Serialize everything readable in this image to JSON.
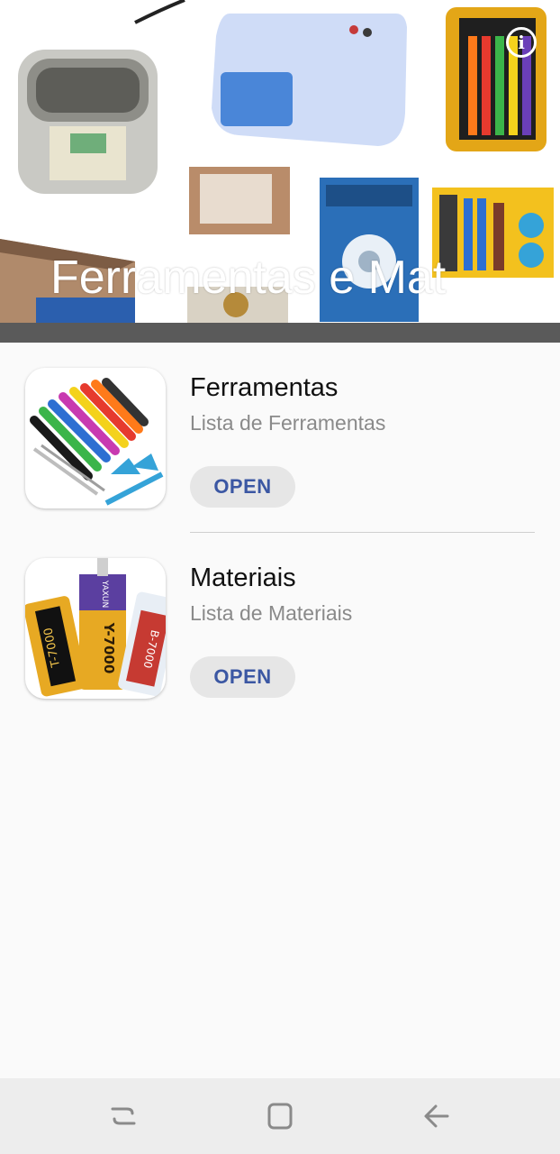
{
  "header": {
    "title": "Ferramentas e Mat",
    "info_icon": "info-icon",
    "info_glyph": "i"
  },
  "items": [
    {
      "title": "Ferramentas",
      "subtitle": "Lista de Ferramentas",
      "button": "OPEN",
      "thumbnail_icon": "screwdriver-set-icon"
    },
    {
      "title": "Materiais",
      "subtitle": "Lista de Materiais",
      "button": "OPEN",
      "thumbnail_icon": "glue-tubes-icon",
      "tube_labels": [
        "T-7000",
        "Y-7000",
        "B-7000"
      ],
      "brand": "YAXUN"
    }
  ],
  "navbar": {
    "recent": "recent-apps-icon",
    "home": "home-icon",
    "back": "back-arrow-icon"
  },
  "colors": {
    "accent": "#3b57a3",
    "button_bg": "#e6e6e6",
    "background": "#fafafa",
    "navbar_bg": "#ededed"
  }
}
